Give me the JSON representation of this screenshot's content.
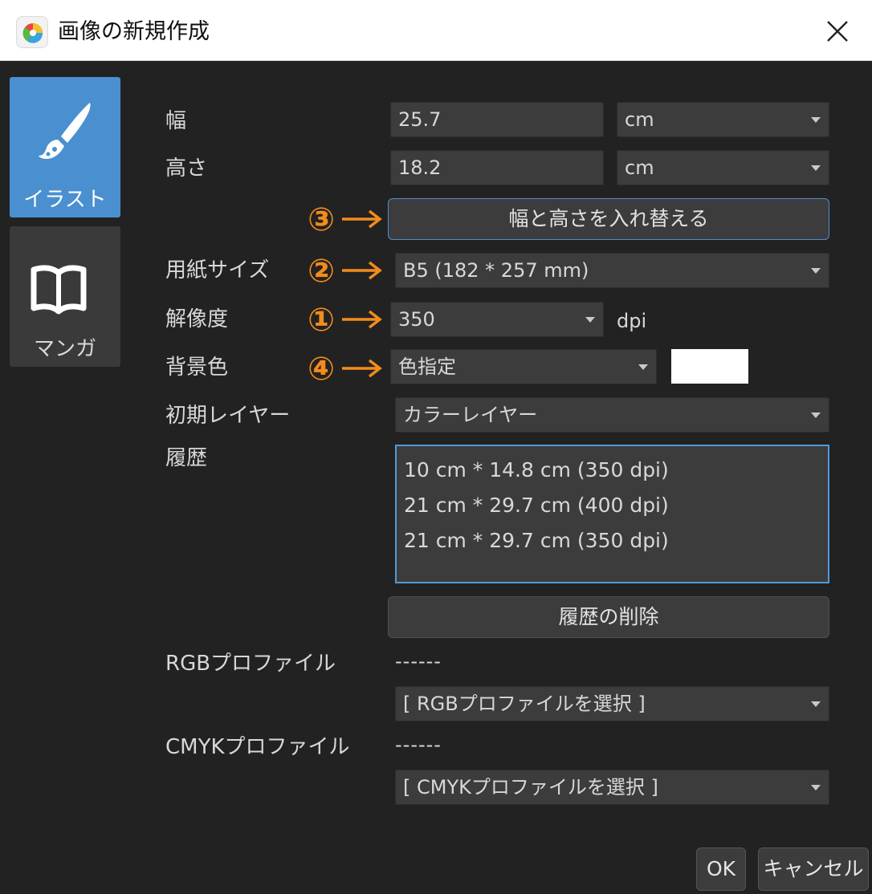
{
  "window": {
    "title": "画像の新規作成"
  },
  "sidebar": {
    "tabs": [
      {
        "label": "イラスト",
        "icon": "brush-icon",
        "active": true
      },
      {
        "label": "マンガ",
        "icon": "book-icon",
        "active": false
      }
    ]
  },
  "form": {
    "width": {
      "label": "幅",
      "value": "25.7",
      "unit": "cm"
    },
    "height": {
      "label": "高さ",
      "value": "18.2",
      "unit": "cm"
    },
    "swap_button": "幅と高さを入れ替える",
    "paper_size": {
      "label": "用紙サイズ",
      "value": "B5 (182 * 257  mm)"
    },
    "resolution": {
      "label": "解像度",
      "value": "350",
      "unit": "dpi"
    },
    "background": {
      "label": "背景色",
      "value": "色指定",
      "swatch_color": "#ffffff"
    },
    "initial_layer": {
      "label": "初期レイヤー",
      "value": "カラーレイヤー"
    },
    "history": {
      "label": "履歴",
      "items": [
        "10 cm * 14.8 cm (350 dpi)",
        "21 cm * 29.7 cm (400 dpi)",
        "21 cm * 29.7 cm (350 dpi)"
      ],
      "delete_button": "履歴の削除"
    },
    "rgb_profile": {
      "label": "RGBプロファイル",
      "current": "------",
      "select": "[ RGBプロファイルを選択 ]"
    },
    "cmyk_profile": {
      "label": "CMYKプロファイル",
      "current": "------",
      "select": "[ CMYKプロファイルを選択 ]"
    }
  },
  "annotations": {
    "one": "①",
    "two": "②",
    "three": "③",
    "four": "④",
    "color": "#f28c1c"
  },
  "footer": {
    "ok": "OK",
    "cancel": "キャンセル"
  }
}
